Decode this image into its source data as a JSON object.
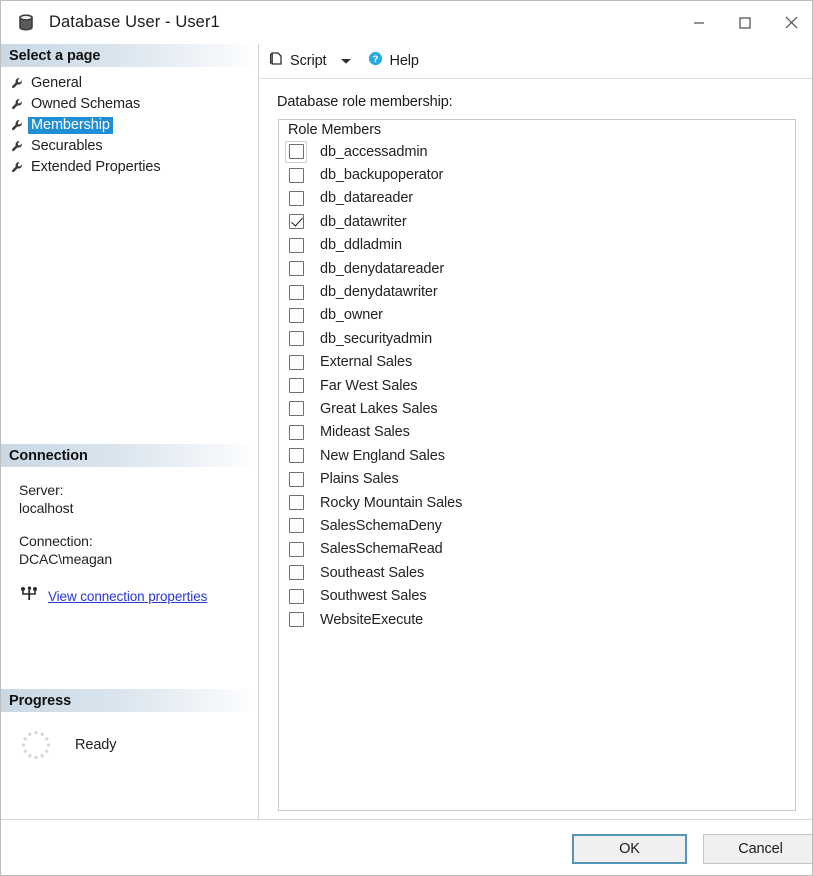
{
  "window": {
    "title": "Database User - User1",
    "icon": "database-icon",
    "controls": {
      "minimize": "minimize-icon",
      "maximize": "maximize-icon",
      "close": "close-icon"
    }
  },
  "sidebar": {
    "select_page_header": "Select a page",
    "pages": [
      {
        "label": "General",
        "selected": false
      },
      {
        "label": "Owned Schemas",
        "selected": false
      },
      {
        "label": "Membership",
        "selected": true
      },
      {
        "label": "Securables",
        "selected": false
      },
      {
        "label": "Extended Properties",
        "selected": false
      }
    ],
    "connection": {
      "header": "Connection",
      "server_label": "Server:",
      "server_value": "localhost",
      "connection_label": "Connection:",
      "connection_value": "DCAC\\meagan",
      "link": "View connection properties",
      "link_icon": "connection-icon"
    },
    "progress": {
      "header": "Progress",
      "status": "Ready",
      "spinner_icon": "progress-spinner-icon"
    }
  },
  "toolbar": {
    "script_label": "Script",
    "script_icon": "script-icon",
    "script_caret_icon": "chevron-down-icon",
    "help_label": "Help",
    "help_icon": "help-icon"
  },
  "main": {
    "field_label": "Database role membership:",
    "list_header": "Role Members",
    "roles": [
      {
        "name": "db_accessadmin",
        "checked": false,
        "focused": true
      },
      {
        "name": "db_backupoperator",
        "checked": false,
        "focused": false
      },
      {
        "name": "db_datareader",
        "checked": false,
        "focused": false
      },
      {
        "name": "db_datawriter",
        "checked": true,
        "focused": false
      },
      {
        "name": "db_ddladmin",
        "checked": false,
        "focused": false
      },
      {
        "name": "db_denydatareader",
        "checked": false,
        "focused": false
      },
      {
        "name": "db_denydatawriter",
        "checked": false,
        "focused": false
      },
      {
        "name": "db_owner",
        "checked": false,
        "focused": false
      },
      {
        "name": "db_securityadmin",
        "checked": false,
        "focused": false
      },
      {
        "name": "External Sales",
        "checked": false,
        "focused": false
      },
      {
        "name": "Far West Sales",
        "checked": false,
        "focused": false
      },
      {
        "name": "Great Lakes Sales",
        "checked": false,
        "focused": false
      },
      {
        "name": "Mideast Sales",
        "checked": false,
        "focused": false
      },
      {
        "name": "New England Sales",
        "checked": false,
        "focused": false
      },
      {
        "name": "Plains Sales",
        "checked": false,
        "focused": false
      },
      {
        "name": "Rocky Mountain Sales",
        "checked": false,
        "focused": false
      },
      {
        "name": "SalesSchemaDeny",
        "checked": false,
        "focused": false
      },
      {
        "name": "SalesSchemaRead",
        "checked": false,
        "focused": false
      },
      {
        "name": "Southeast Sales",
        "checked": false,
        "focused": false
      },
      {
        "name": "Southwest Sales",
        "checked": false,
        "focused": false
      },
      {
        "name": "WebsiteExecute",
        "checked": false,
        "focused": false
      }
    ]
  },
  "footer": {
    "ok_label": "OK",
    "cancel_label": "Cancel"
  },
  "colors": {
    "accent": "#1e8fd6",
    "link": "#2737d4",
    "header_gradient_start": "#c9d8e4",
    "focus_border": "#5596b8",
    "help_icon": "#29a9df"
  }
}
